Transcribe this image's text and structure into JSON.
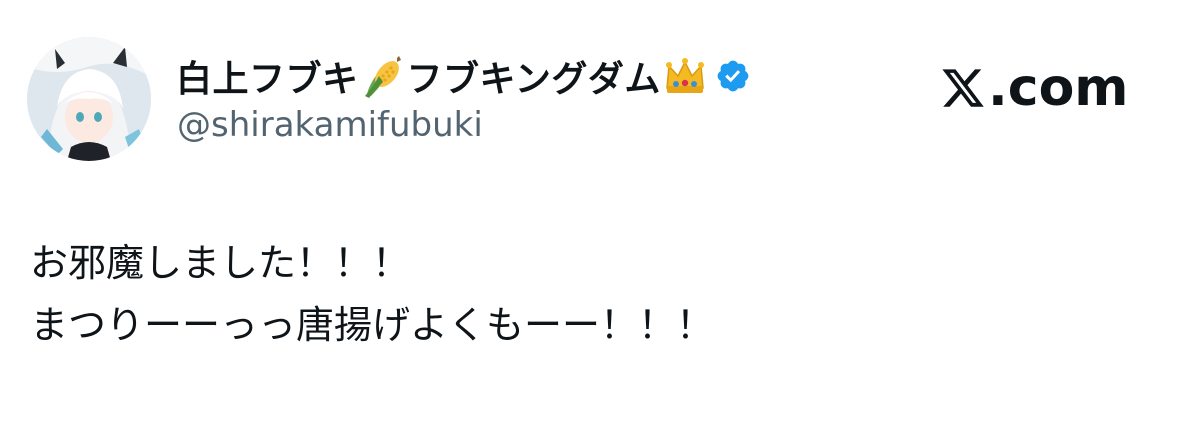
{
  "author": {
    "name_part1": "白上フブキ",
    "name_emoji1": "corn-emoji",
    "name_part2": "フブキングダム",
    "name_emoji2": "crown-emoji",
    "verified_icon": "verified-badge-icon",
    "handle": "@shirakamifubuki"
  },
  "brand": {
    "icon": "x-logo-icon",
    "suffix": ".com"
  },
  "tweet": {
    "lines": [
      "お邪魔しました！！！",
      "まつりーーっっ唐揚げよくもーー！！！"
    ]
  },
  "colors": {
    "text": "#0f1419",
    "handle": "#536471",
    "verified": "#1d9bf0"
  }
}
